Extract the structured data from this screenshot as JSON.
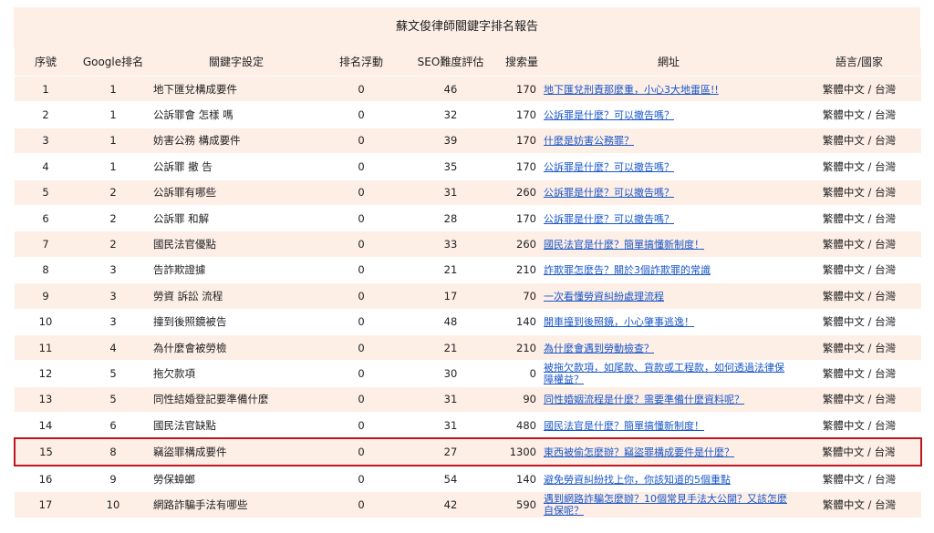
{
  "report_title": "蘇文俊律師關鍵字排名報告",
  "columns": [
    "序號",
    "Google排名",
    "關鍵字設定",
    "排名浮動",
    "SEO難度評估",
    "搜索量",
    "網址",
    "語言/國家"
  ],
  "highlight_color": "#c0141e",
  "rows": [
    {
      "no": "1",
      "rank": "1",
      "keyword": "地下匯兌構成要件",
      "float": "0",
      "seo": "46",
      "volume": "170",
      "url": "地下匯兌刑責那麼重，小心3大地雷區!!",
      "lang": "繁體中文 / 台灣"
    },
    {
      "no": "2",
      "rank": "1",
      "keyword": "公訴罪會 怎樣 嗎",
      "float": "0",
      "seo": "32",
      "volume": "170",
      "url": "公訴罪是什麼？可以撤告嗎？",
      "lang": "繁體中文 / 台灣"
    },
    {
      "no": "3",
      "rank": "1",
      "keyword": "妨害公務 構成要件",
      "float": "0",
      "seo": "39",
      "volume": "170",
      "url": "什麼是妨害公務罪？",
      "lang": "繁體中文 / 台灣"
    },
    {
      "no": "4",
      "rank": "1",
      "keyword": "公訴罪 撤 告",
      "float": "0",
      "seo": "35",
      "volume": "170",
      "url": "公訴罪是什麼？可以撤告嗎？",
      "lang": "繁體中文 / 台灣"
    },
    {
      "no": "5",
      "rank": "2",
      "keyword": "公訴罪有哪些",
      "float": "0",
      "seo": "31",
      "volume": "260",
      "url": "公訴罪是什麼？可以撤告嗎？",
      "lang": "繁體中文 / 台灣"
    },
    {
      "no": "6",
      "rank": "2",
      "keyword": "公訴罪 和解",
      "float": "0",
      "seo": "28",
      "volume": "170",
      "url": "公訴罪是什麼？可以撤告嗎？",
      "lang": "繁體中文 / 台灣"
    },
    {
      "no": "7",
      "rank": "2",
      "keyword": "國民法官優點",
      "float": "0",
      "seo": "33",
      "volume": "260",
      "url": "國民法官是什麼？簡單搞懂新制度！",
      "lang": "繁體中文 / 台灣"
    },
    {
      "no": "8",
      "rank": "3",
      "keyword": "告詐欺證據",
      "float": "0",
      "seo": "21",
      "volume": "210",
      "url": "詐欺罪怎麼告？關於3個詐欺罪的常識",
      "lang": "繁體中文 / 台灣"
    },
    {
      "no": "9",
      "rank": "3",
      "keyword": "勞資 訴訟 流程",
      "float": "0",
      "seo": "17",
      "volume": "70",
      "url": "一次看懂勞資糾紛處理流程",
      "lang": "繁體中文 / 台灣"
    },
    {
      "no": "10",
      "rank": "3",
      "keyword": "撞到後照鏡被告",
      "float": "0",
      "seo": "48",
      "volume": "140",
      "url": "開車撞到後照鏡，小心肇事逃逸！",
      "lang": "繁體中文 / 台灣"
    },
    {
      "no": "11",
      "rank": "4",
      "keyword": "為什麼會被勞檢",
      "float": "0",
      "seo": "21",
      "volume": "210",
      "url": "為什麼會遇到勞動檢查？",
      "lang": "繁體中文 / 台灣"
    },
    {
      "no": "12",
      "rank": "5",
      "keyword": "拖欠款項",
      "float": "0",
      "seo": "30",
      "volume": "0",
      "url": "被拖欠款項，如尾款、貨款或工程款，如何透過法律保障權益？",
      "lang": "繁體中文 / 台灣",
      "wrap": true
    },
    {
      "no": "13",
      "rank": "5",
      "keyword": "同性結婚登記要準備什麼",
      "float": "0",
      "seo": "31",
      "volume": "90",
      "url": "同性婚姻流程是什麼？需要準備什麼資料呢？",
      "lang": "繁體中文 / 台灣"
    },
    {
      "no": "14",
      "rank": "6",
      "keyword": "國民法官缺點",
      "float": "0",
      "seo": "31",
      "volume": "480",
      "url": "國民法官是什麼？簡單搞懂新制度！",
      "lang": "繁體中文 / 台灣"
    },
    {
      "no": "15",
      "rank": "8",
      "keyword": "竊盜罪構成要件",
      "float": "0",
      "seo": "27",
      "volume": "1300",
      "url": "東西被偷怎麼辦？竊盜罪構成要件是什麼？",
      "lang": "繁體中文 / 台灣",
      "highlight": true
    },
    {
      "no": "16",
      "rank": "9",
      "keyword": "勞保蟑螂",
      "float": "0",
      "seo": "54",
      "volume": "140",
      "url": "避免勞資糾紛找上你，你該知道的5個重點",
      "lang": "繁體中文 / 台灣"
    },
    {
      "no": "17",
      "rank": "10",
      "keyword": "網路詐騙手法有哪些",
      "float": "0",
      "seo": "42",
      "volume": "590",
      "url": "遇到網路詐騙怎麼辦？10個常見手法大公開？又該怎麼自保呢？",
      "lang": "繁體中文 / 台灣",
      "wrap": true
    }
  ]
}
